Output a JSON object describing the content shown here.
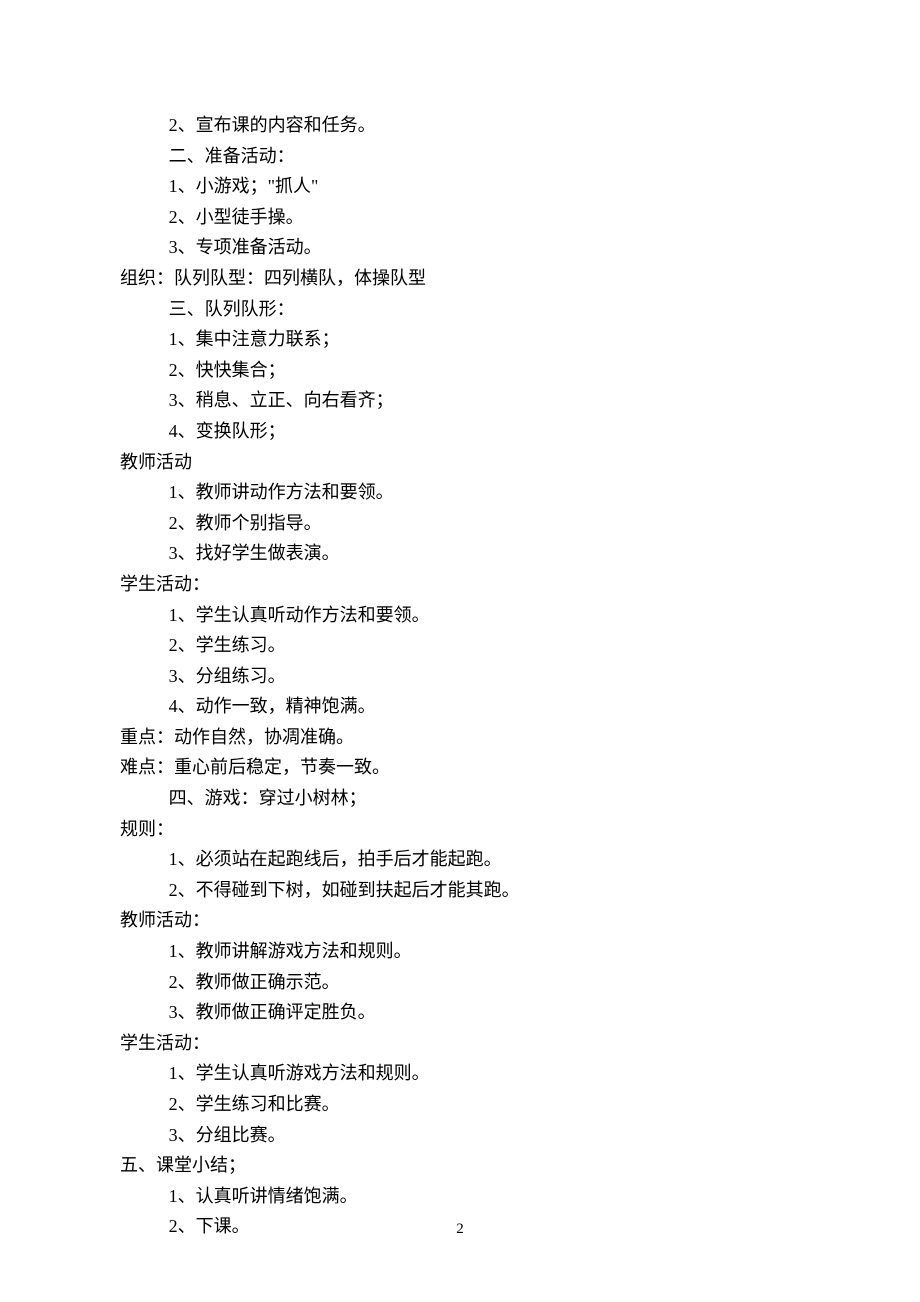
{
  "lines": [
    {
      "indent": 1,
      "text": "2、宣布课的内容和任务。"
    },
    {
      "indent": 1,
      "text": "二、准备活动："
    },
    {
      "indent": 1,
      "text": "1、小游戏；\"抓人\""
    },
    {
      "indent": 1,
      "text": "2、小型徒手操。"
    },
    {
      "indent": 1,
      "text": "3、专项准备活动。"
    },
    {
      "indent": 0,
      "text": "组织：队列队型：四列横队，体操队型"
    },
    {
      "indent": 1,
      "text": "三、队列队形："
    },
    {
      "indent": 1,
      "text": "1、集中注意力联系；"
    },
    {
      "indent": 1,
      "text": "2、快快集合；"
    },
    {
      "indent": 1,
      "text": "3、稍息、立正、向右看齐；"
    },
    {
      "indent": 1,
      "text": "4、变换队形；"
    },
    {
      "indent": 0,
      "text": "教师活动"
    },
    {
      "indent": 1,
      "text": "1、教师讲动作方法和要领。"
    },
    {
      "indent": 1,
      "text": "2、教师个别指导。"
    },
    {
      "indent": 1,
      "text": "3、找好学生做表演。"
    },
    {
      "indent": 0,
      "text": "学生活动："
    },
    {
      "indent": 1,
      "text": "1、学生认真听动作方法和要领。"
    },
    {
      "indent": 1,
      "text": "2、学生练习。"
    },
    {
      "indent": 1,
      "text": "3、分组练习。"
    },
    {
      "indent": 1,
      "text": "4、动作一致，精神饱满。"
    },
    {
      "indent": 0,
      "text": "重点：动作自然，协凋准确。"
    },
    {
      "indent": 0,
      "text": "难点：重心前后稳定，节奏一致。"
    },
    {
      "indent": 1,
      "text": "四、游戏：穿过小树林；"
    },
    {
      "indent": 0,
      "text": "规则："
    },
    {
      "indent": 1,
      "text": "1、必须站在起跑线后，拍手后才能起跑。"
    },
    {
      "indent": 1,
      "text": "2、不得碰到下树，如碰到扶起后才能其跑。"
    },
    {
      "indent": 0,
      "text": "教师活动："
    },
    {
      "indent": 1,
      "text": "1、教师讲解游戏方法和规则。"
    },
    {
      "indent": 1,
      "text": "2、教师做正确示范。"
    },
    {
      "indent": 1,
      "text": "3、教师做正确评定胜负。"
    },
    {
      "indent": 0,
      "text": "学生活动："
    },
    {
      "indent": 1,
      "text": "1、学生认真听游戏方法和规则。"
    },
    {
      "indent": 1,
      "text": "2、学生练习和比赛。"
    },
    {
      "indent": 1,
      "text": "3、分组比赛。"
    },
    {
      "indent": 0,
      "text": "五、课堂小结；"
    },
    {
      "indent": 1,
      "text": "1、认真听讲情绪饱满。"
    },
    {
      "indent": 1,
      "text": "2、下课。"
    }
  ],
  "pageNumber": "2"
}
